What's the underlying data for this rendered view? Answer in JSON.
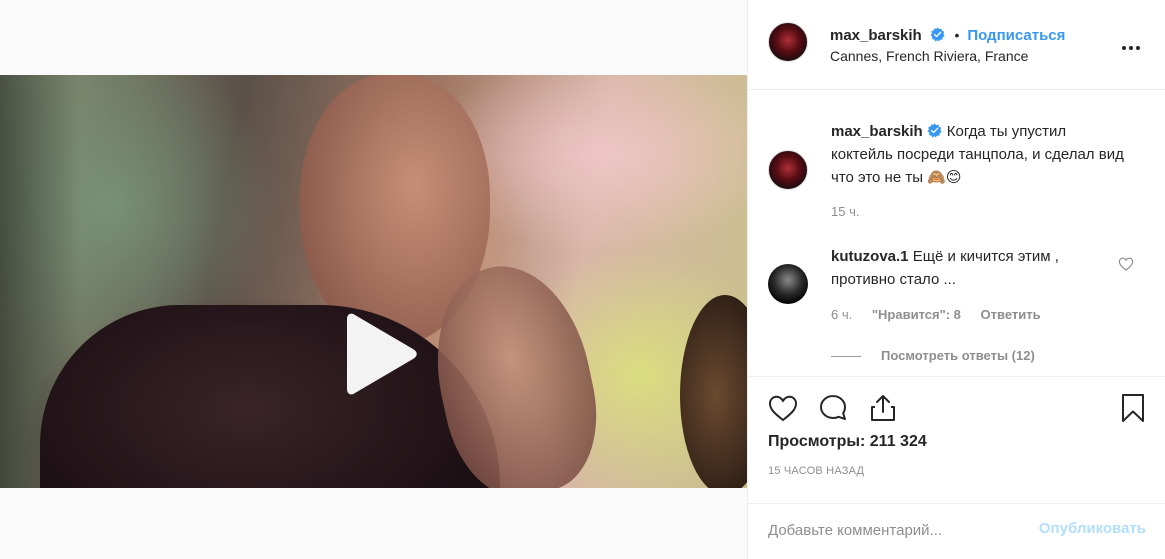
{
  "post": {
    "username": "max_barskih",
    "follow_label": "Подписаться",
    "separator": "•",
    "location": "Cannes, French Riviera, France",
    "caption_username": "max_barskih",
    "caption_text": "Когда ты упустил коктейль посреди танцпола, и сделал вид что это не ты 🙈😊 ",
    "caption_time": "15 ч."
  },
  "comment": {
    "username": "kutuzova.1",
    "text": "Ещё и кичится этим , противно стало ...",
    "time": "6 ч.",
    "likes": "\"Нравится\": 8",
    "reply_label": "Ответить",
    "view_replies": "Посмотреть ответы (12)"
  },
  "stats": {
    "views": "Просмотры: 211 324",
    "posted_ago": "15 ЧАСОВ НАЗАД"
  },
  "composer": {
    "placeholder": "Добавьте комментарий...",
    "publish_label": "Опубликовать"
  },
  "colors": {
    "accent": "#3897f0",
    "publish_disabled": "#b2dffc",
    "muted": "#8e8e8e"
  },
  "icons": [
    "play-icon",
    "verified-badge-icon",
    "more-options-icon",
    "heart-icon",
    "comment-icon",
    "share-icon",
    "bookmark-icon"
  ]
}
